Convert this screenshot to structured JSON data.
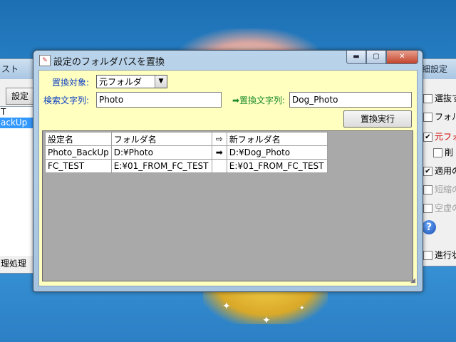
{
  "background_left": {
    "title": "スト",
    "button_label": "設定",
    "list_items": [
      "T",
      "ackUp"
    ],
    "bottom_label": "理処理"
  },
  "background_right": {
    "title": "細設定",
    "rows": [
      "選抜す",
      "フォルタ",
      "元フォル",
      "削",
      "適用の",
      "短縮の",
      "空虚の",
      "進行状"
    ]
  },
  "dialog": {
    "title": "設定のフォルダパスを置換",
    "window_buttons": {
      "minimize": "▬",
      "maximize": "▢",
      "close": "✕"
    },
    "target_label": "置換対象:",
    "target_value": "元フォルダ",
    "search_label": "検索文字列:",
    "search_value": "Photo",
    "replace_label": "➡置換文字列:",
    "replace_value": "Dog_Photo",
    "execute_label": "置換実行",
    "table": {
      "headers": [
        "設定名",
        "フォルダ名",
        "⇨",
        "新フォルダ名"
      ],
      "rows": [
        [
          "Photo_BackUp",
          "D:¥Photo",
          "➡",
          "D:¥Dog_Photo"
        ],
        [
          "FC_TEST",
          "E:¥01_FROM_FC_TEST",
          "",
          "E:¥01_FROM_FC_TEST"
        ]
      ]
    }
  }
}
